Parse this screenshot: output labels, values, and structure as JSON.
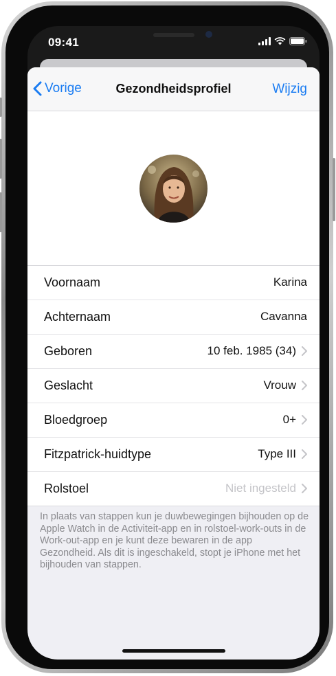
{
  "status_bar": {
    "time": "09:41"
  },
  "nav": {
    "back_label": "Vorige",
    "title": "Gezondheidsprofiel",
    "edit_label": "Wijzig"
  },
  "profile": {
    "rows": [
      {
        "label": "Voornaam",
        "value": "Karina",
        "chevron": false,
        "muted": false
      },
      {
        "label": "Achternaam",
        "value": "Cavanna",
        "chevron": false,
        "muted": false
      },
      {
        "label": "Geboren",
        "value": "10 feb. 1985 (34)",
        "chevron": true,
        "muted": false
      },
      {
        "label": "Geslacht",
        "value": "Vrouw",
        "chevron": true,
        "muted": false
      },
      {
        "label": "Bloedgroep",
        "value": "0+",
        "chevron": true,
        "muted": false
      },
      {
        "label": "Fitzpatrick-huidtype",
        "value": "Type III",
        "chevron": true,
        "muted": false
      },
      {
        "label": "Rolstoel",
        "value": "Niet ingesteld",
        "chevron": true,
        "muted": true
      }
    ],
    "footnote": "In plaats van stappen kun je duwbewegingen bijhouden op de Apple Watch in de Activiteit-app en in rolstoel-work-outs in de Work-out-app en je kunt deze bewaren in de app Gezondheid. Als dit is ingeschakeld, stopt je iPhone met het bijhouden van stappen."
  },
  "icons": {
    "back": "chevron-left-icon",
    "row_chevron": "chevron-right-icon",
    "signal": "cellular-signal-icon",
    "wifi": "wifi-icon",
    "battery": "battery-icon"
  },
  "colors": {
    "accent": "#1a7cf2",
    "placeholder": "#c4c4c8",
    "background": "#efeff4"
  }
}
